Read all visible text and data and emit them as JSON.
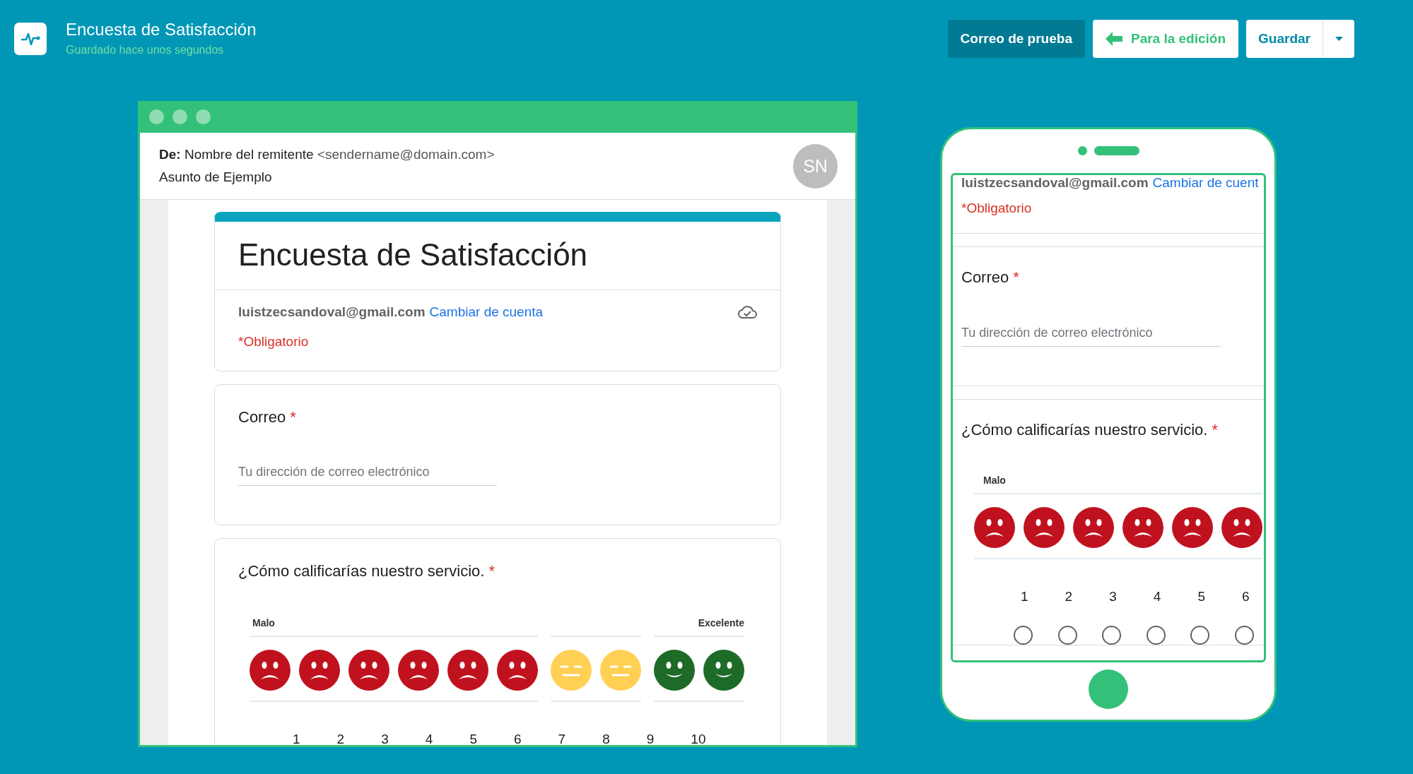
{
  "app_header": {
    "title": "Encuesta de Satisfacción",
    "subtitle": "Guardado hace unos segundos",
    "buttons": [
      {
        "label": "Correo de prueba",
        "kind": "dark"
      },
      {
        "label": "Para la edición",
        "kind": "back"
      },
      {
        "label": "Guardar",
        "kind": "split"
      }
    ]
  },
  "email_preview": {
    "from_label": "De:",
    "sender_name": "Nombre del remitente",
    "sender_email": "<sendername@domain.com>",
    "subject": "Asunto de Ejemplo",
    "avatar": "SN",
    "form": {
      "title": "Encuesta de Satisfacción",
      "account_email": "luistzecsandoval@gmail.com",
      "switch_account_link": "Cambiar de cuenta",
      "required_note": "*Obligatorio",
      "questions": [
        {
          "kind": "text",
          "label": "Correo",
          "required_mark": "*",
          "placeholder": "Tu dirección de correo electrónico"
        },
        {
          "kind": "scale",
          "label": "¿Cómo calificarías nuestro servicio.",
          "required_mark": "*",
          "low_label": "Malo",
          "high_label": "Excelente",
          "options": [
            {
              "number": "1",
              "kind": "sad"
            },
            {
              "number": "2",
              "kind": "sad"
            },
            {
              "number": "3",
              "kind": "sad"
            },
            {
              "number": "4",
              "kind": "sad"
            },
            {
              "number": "5",
              "kind": "sad"
            },
            {
              "number": "6",
              "kind": "sad"
            },
            {
              "number": "7",
              "kind": "neutral"
            },
            {
              "number": "8",
              "kind": "neutral"
            },
            {
              "number": "9",
              "kind": "happy"
            },
            {
              "number": "10",
              "kind": "happy"
            }
          ]
        }
      ]
    }
  },
  "mobile_preview": {
    "account_email": "luistzecsandoval@gmail.com",
    "switch_account_link": "Cambiar de cuent",
    "required_note": "*Obligatorio",
    "questions": [
      {
        "kind": "text",
        "label": "Correo",
        "required_mark": "*",
        "placeholder": "Tu dirección de correo electrónico"
      },
      {
        "kind": "scale",
        "label": "¿Cómo calificarías nuestro servicio.",
        "required_mark": "*",
        "low_label": "Malo",
        "options": [
          {
            "number": "1",
            "kind": "sad",
            "selected": false
          },
          {
            "number": "2",
            "kind": "sad",
            "selected": false
          },
          {
            "number": "3",
            "kind": "sad",
            "selected": false
          },
          {
            "number": "4",
            "kind": "sad",
            "selected": false
          },
          {
            "number": "5",
            "kind": "sad",
            "selected": false
          },
          {
            "number": "6",
            "kind": "sad",
            "selected": false
          }
        ]
      }
    ]
  }
}
